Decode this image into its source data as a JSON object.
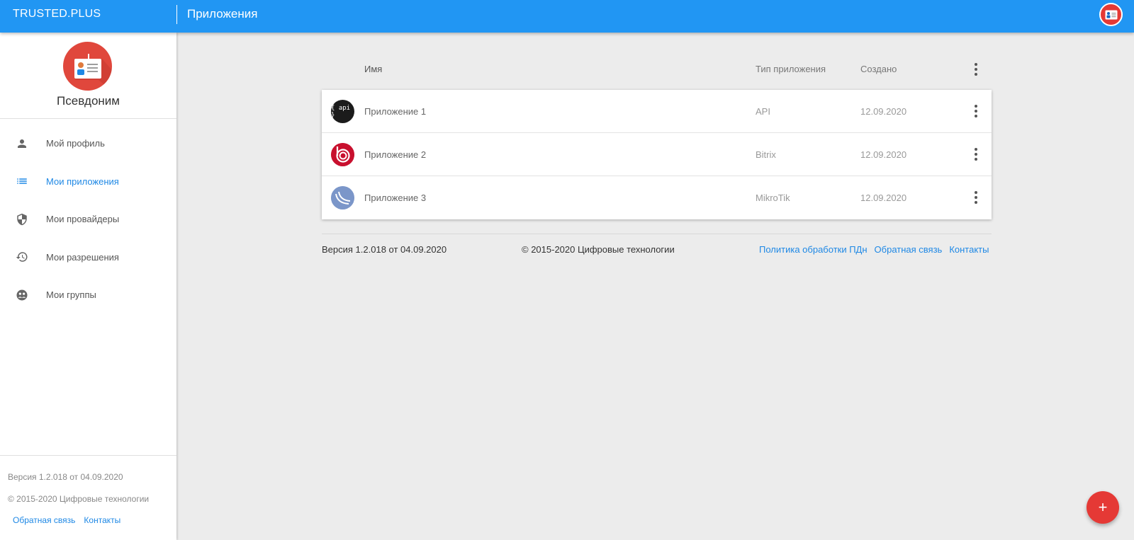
{
  "header": {
    "brand": "TRUSTED.PLUS",
    "title": "Приложения"
  },
  "profile": {
    "name": "Псевдоним"
  },
  "sidebar": {
    "items": [
      {
        "label": "Мой профиль",
        "icon": "person-icon",
        "active": false
      },
      {
        "label": "Мои приложения",
        "icon": "list-icon",
        "active": true
      },
      {
        "label": "Мои провайдеры",
        "icon": "shield-icon",
        "active": false
      },
      {
        "label": "Мои разрешения",
        "icon": "history-icon",
        "active": false
      },
      {
        "label": "Мои группы",
        "icon": "groups-icon",
        "active": false
      }
    ],
    "footer": {
      "version": "Версия 1.2.018 от 04.09.2020",
      "copyright": "© 2015-2020 Цифровые технологии",
      "links": [
        "Обратная связь",
        "Контакты"
      ]
    }
  },
  "table": {
    "columns": {
      "name": "Имя",
      "type": "Тип приложения",
      "created": "Создано"
    },
    "rows": [
      {
        "name": "Приложение 1",
        "type": "API",
        "created": "12.09.2020",
        "logo": "api-logo-icon",
        "logo_text": "{ api }"
      },
      {
        "name": "Приложение 2",
        "type": "Bitrix",
        "created": "12.09.2020",
        "logo": "bitrix-logo-icon"
      },
      {
        "name": "Приложение 3",
        "type": "MikroTik",
        "created": "12.09.2020",
        "logo": "mikrotik-logo-icon"
      }
    ]
  },
  "footer": {
    "version": "Версия 1.2.018 от 04.09.2020",
    "copyright": "© 2015-2020 Цифровые технологии",
    "links": [
      "Политика обработки ПДн",
      "Обратная связь",
      "Контакты"
    ]
  },
  "fab": {
    "label": "+"
  },
  "colors": {
    "primary": "#2196f3",
    "accent": "#e53935",
    "link": "#1e88e5",
    "background": "#ececec"
  }
}
